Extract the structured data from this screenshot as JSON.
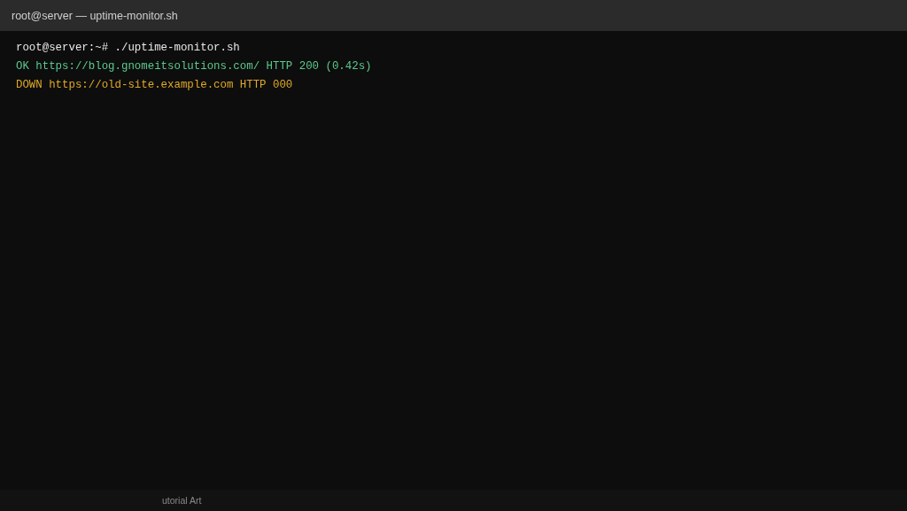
{
  "window": {
    "title": "root@server — uptime-monitor.sh"
  },
  "terminal": {
    "lines": [
      {
        "kind": "command",
        "text": "root@server:~# ./uptime-monitor.sh"
      },
      {
        "kind": "ok",
        "text": "OK https://blog.gnomeitsolutions.com/ HTTP 200 (0.42s)"
      },
      {
        "kind": "down",
        "text": "DOWN https://old-site.example.com HTTP 000"
      }
    ]
  },
  "status_bar": {
    "text": "utorial Art"
  }
}
